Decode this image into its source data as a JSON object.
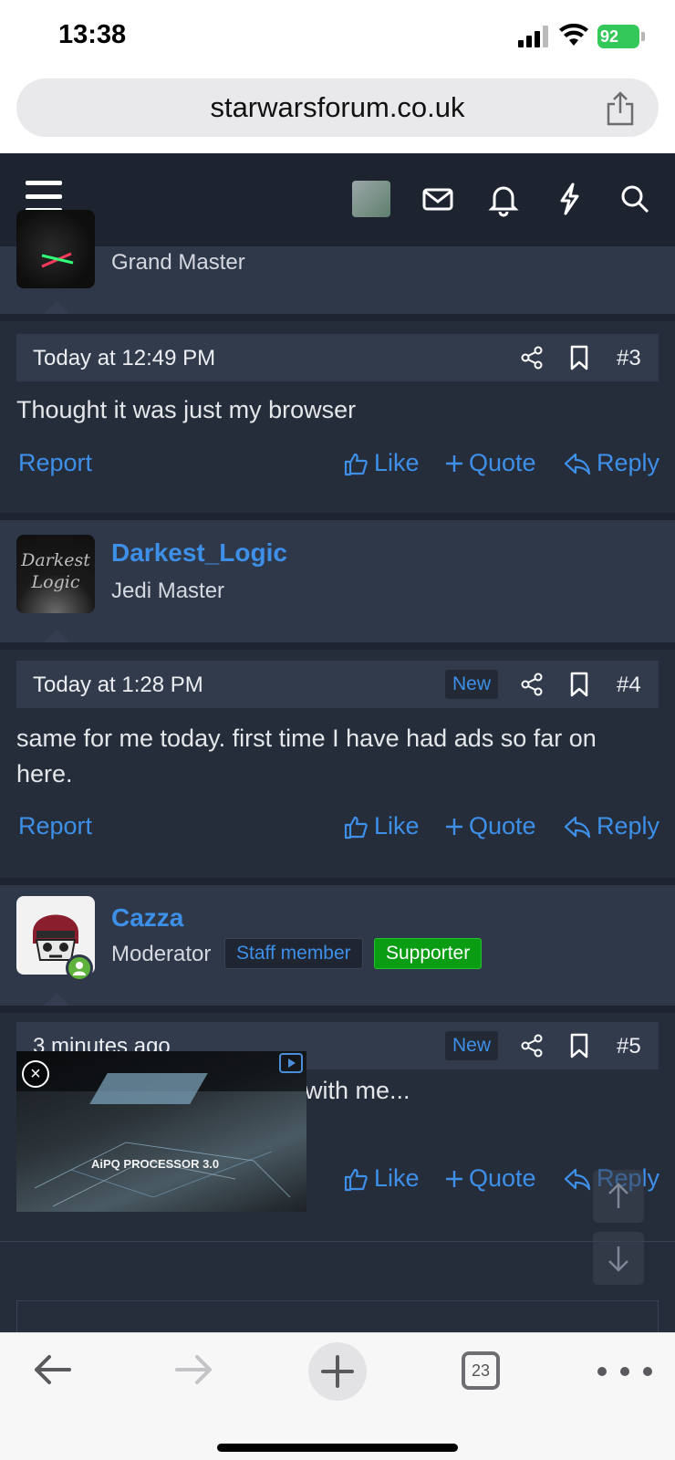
{
  "status_bar": {
    "time": "13:38",
    "battery": "92"
  },
  "browser": {
    "url": "starwarsforum.co.uk",
    "tab_count": "23"
  },
  "posts": [
    {
      "user_title": "Grand Master",
      "date": "Today at 12:49 PM",
      "number": "#3",
      "message": "Thought it was just my browser"
    },
    {
      "username": "Darkest_Logic",
      "user_title": "Jedi Master",
      "avatar_text": [
        "Darkest",
        "Logic"
      ],
      "date": "Today at 1:28 PM",
      "new_tag": "New",
      "number": "#4",
      "message": "same for me today. first time I have had ads so far on here."
    },
    {
      "username": "Cazza",
      "user_title": "Moderator",
      "staff_badge": "Staff member",
      "supporter_badge": "Supporter",
      "date": "3 minutes ago",
      "new_tag": "New",
      "number": "#5",
      "message_visible_fragment": "with me..."
    }
  ],
  "actions": {
    "report": "Report",
    "like": "Like",
    "quote": "Quote",
    "reply": "Reply"
  },
  "ad": {
    "text": "AiPQ PROCESSOR 3.0",
    "close_symbol": "×"
  }
}
